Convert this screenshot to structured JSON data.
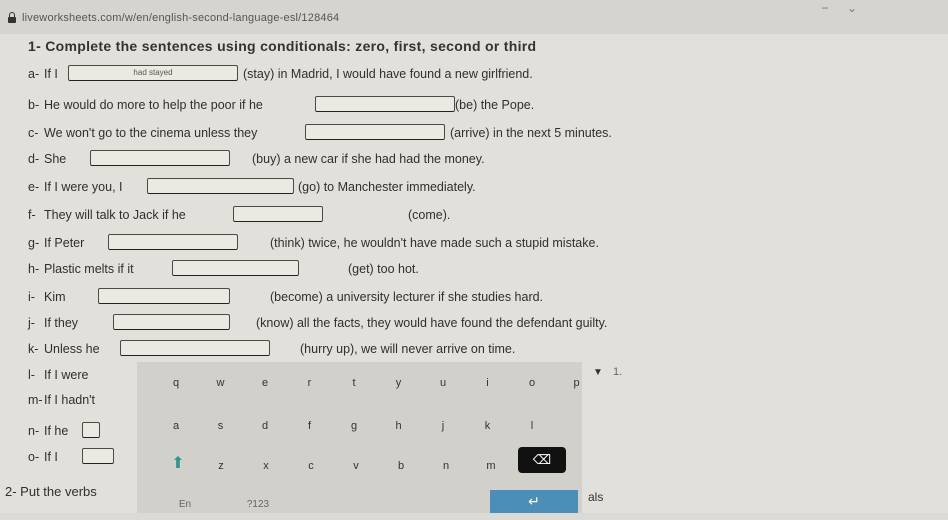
{
  "browser": {
    "url": "liveworksheets.com/w/en/english-second-language-esl/128464"
  },
  "worksheet": {
    "heading": "1- Complete the sentences using conditionals: zero, first, second or third",
    "section2": "2- Put the verbs",
    "section2_tail": "als",
    "items": [
      {
        "letter": "a-",
        "pre": "If I",
        "answer": "had stayed",
        "post": "(stay) in Madrid, I would have found a new girlfriend."
      },
      {
        "letter": "b-",
        "pre": "He would do more to help the poor if he",
        "answer": "",
        "post": "(be) the Pope."
      },
      {
        "letter": "c-",
        "pre": "We won't go to the cinema unless they",
        "answer": "",
        "post": "(arrive) in the next 5 minutes."
      },
      {
        "letter": "d-",
        "pre": "She",
        "answer": "",
        "post": "(buy) a new car if she had had the money."
      },
      {
        "letter": "e-",
        "pre": "If I were you, I",
        "answer": "",
        "post": "(go) to Manchester immediately."
      },
      {
        "letter": "f-",
        "pre": "They will talk to Jack if he",
        "answer": "",
        "post": "(come)."
      },
      {
        "letter": "g-",
        "pre": "If Peter",
        "answer": "",
        "post": "(think) twice, he wouldn't have made such a stupid mistake."
      },
      {
        "letter": "h-",
        "pre": "Plastic melts if it",
        "answer": "",
        "post": "(get) too hot."
      },
      {
        "letter": "i-",
        "pre": "Kim",
        "answer": "",
        "post": "(become) a university lecturer if she studies hard."
      },
      {
        "letter": "j-",
        "pre": "If they",
        "answer": "",
        "post": "(know) all the facts, they would have found the defendant guilty."
      },
      {
        "letter": "k-",
        "pre": "Unless he",
        "answer": "",
        "post": "(hurry up), we will never arrive on time."
      },
      {
        "letter": "l-",
        "pre": "If I were",
        "answer": "",
        "post": ""
      },
      {
        "letter": "m-",
        "pre": "If I hadn't",
        "answer": "",
        "post": ""
      },
      {
        "letter": "n-",
        "pre": "If he",
        "answer": "",
        "post": ""
      },
      {
        "letter": "o-",
        "pre": "If I",
        "answer": "",
        "post": ""
      }
    ],
    "side_hint": "1."
  },
  "keyboard": {
    "row1": [
      "q",
      "w",
      "e",
      "r",
      "t",
      "y",
      "u",
      "i",
      "o",
      "p"
    ],
    "row2": [
      "a",
      "s",
      "d",
      "f",
      "g",
      "h",
      "j",
      "k",
      "l"
    ],
    "row3": [
      "z",
      "x",
      "c",
      "v",
      "b",
      "n",
      "m"
    ],
    "shift_icon": "shift-arrow-icon",
    "backspace_icon": "backspace-icon",
    "bottom_left": "En",
    "bottom_num": "?123",
    "enter_icon": "enter-arrow-icon",
    "accent": "#4b8fb8"
  }
}
